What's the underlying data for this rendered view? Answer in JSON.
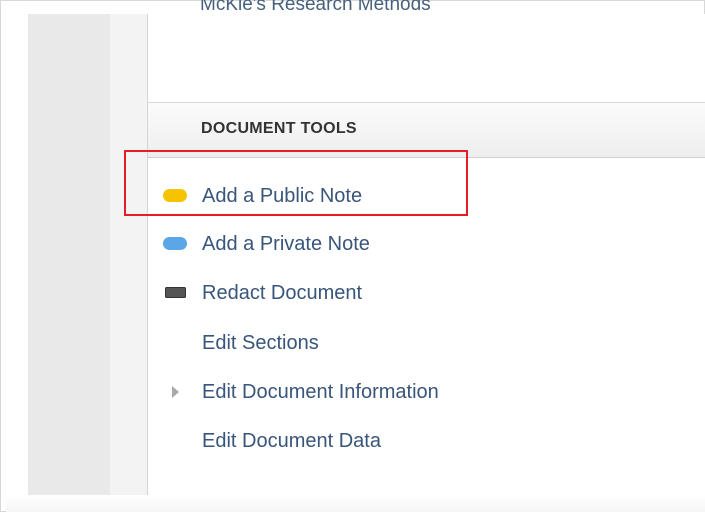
{
  "panel": {
    "top_title": "McKie's Research Methods"
  },
  "document_tools": {
    "header": "DOCUMENT TOOLS",
    "items": [
      {
        "label": "Add a Public Note",
        "icon": "yellow-note-icon",
        "color": "#f5c400"
      },
      {
        "label": "Add a Private Note",
        "icon": "blue-note-icon",
        "color": "#5aa6e6"
      },
      {
        "label": "Redact Document",
        "icon": "redact-icon",
        "color": "#555555"
      },
      {
        "label": "Edit Sections",
        "icon": ""
      },
      {
        "label": "Edit Document Information",
        "icon": "expand-triangle-icon",
        "color": "#a8a8a8"
      },
      {
        "label": "Edit Document Data",
        "icon": ""
      }
    ]
  },
  "annotation": {
    "highlight_color": "#e81c24",
    "highlighted_item": "Add a Public Note"
  }
}
